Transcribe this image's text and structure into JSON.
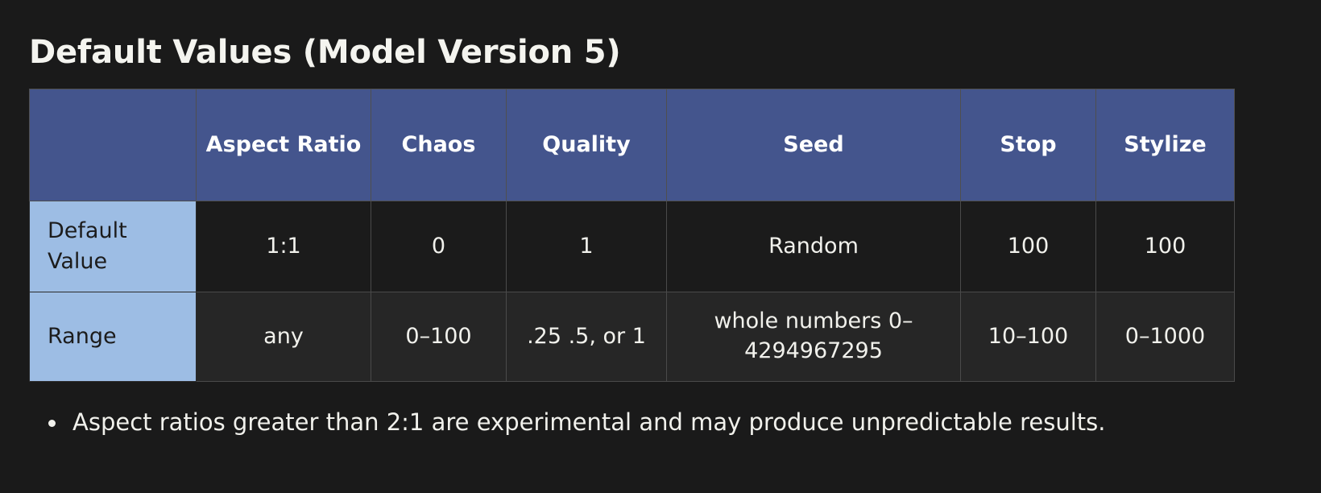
{
  "page": {
    "title": "Default Values (Model Version 5)",
    "background_color": "#1a1a1a",
    "text_color": "#f1f1ec"
  },
  "colors": {
    "header_blue": "#44558d",
    "label_light_blue": "#9dbde4",
    "row_default_bg": "#1b1b1b",
    "row_range_bg": "#262626",
    "grid_line": "#4f4f4f"
  },
  "table": {
    "corner_header": "",
    "headers": [
      "Aspect Ratio",
      "Chaos",
      "Quality",
      "Seed",
      "Stop",
      "Stylize"
    ],
    "rows": [
      {
        "label": "Default Value",
        "values": [
          "1:1",
          "0",
          "1",
          "Random",
          "100",
          "100"
        ]
      },
      {
        "label": "Range",
        "values": [
          "any",
          "0–100",
          ".25 .5, or 1",
          "whole numbers 0–4294967295",
          "10–100",
          "0–1000"
        ]
      }
    ]
  },
  "notes": [
    "Aspect ratios greater than 2:1 are experimental and may produce unpredictable results."
  ]
}
